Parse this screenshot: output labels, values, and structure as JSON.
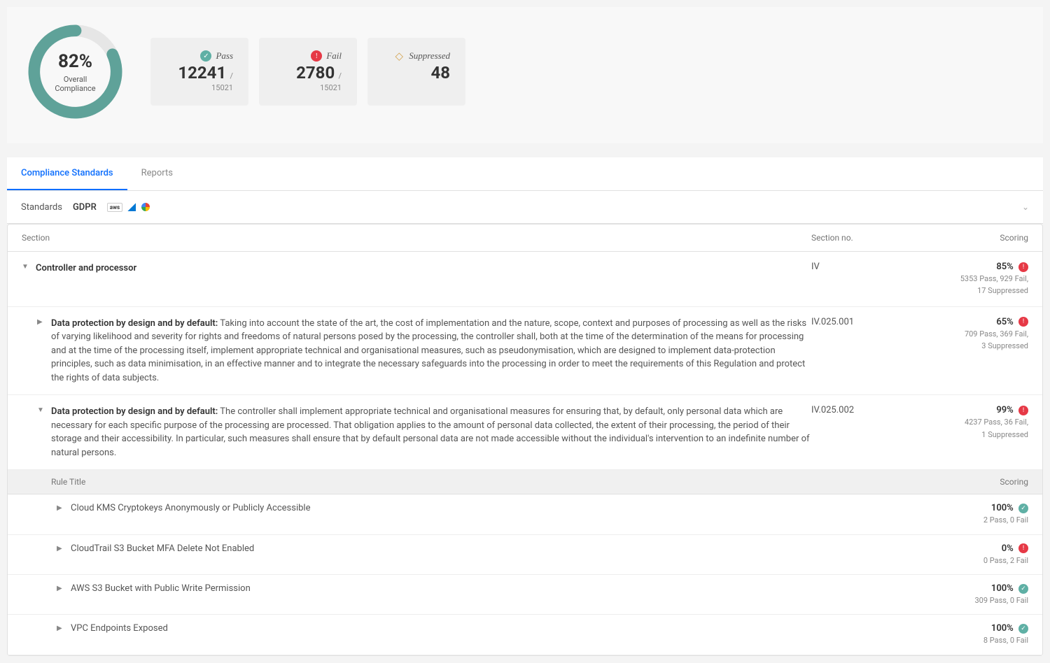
{
  "summary": {
    "overall_pct": "82%",
    "overall_label": "Overall Compliance",
    "pass": {
      "label": "Pass",
      "value": "12241",
      "total": "/ 15021"
    },
    "fail": {
      "label": "Fail",
      "value": "2780",
      "total": "/ 15021"
    },
    "suppressed": {
      "label": "Suppressed",
      "value": "48"
    }
  },
  "tabs": {
    "compliance": "Compliance Standards",
    "reports": "Reports"
  },
  "standards": {
    "label": "Standards",
    "value": "GDPR"
  },
  "table_headers": {
    "section": "Section",
    "section_no": "Section no.",
    "scoring": "Scoring",
    "rule_title": "Rule Title"
  },
  "rows": {
    "main": {
      "title": "Controller and processor",
      "section_no": "IV",
      "score_pct": "85%",
      "score_detail_1": "5353 Pass, 929 Fail,",
      "score_detail_2": "17 Suppressed"
    },
    "sub1": {
      "bold": "Data protection by design and by default:",
      "text": " Taking into account the state of the art, the cost of implementation and the nature, scope, context and purposes of processing as well as the risks of varying likelihood and severity for rights and freedoms of natural persons posed by the processing, the controller shall, both at the time of the determination of the means for processing and at the time of the processing itself, implement appropriate technical and organisational measures, such as pseudonymisation, which are designed to implement data-protection principles, such as data minimisation, in an effective manner and to integrate the necessary safeguards into the processing in order to meet the requirements of this Regulation and protect the rights of data subjects.",
      "section_no": "IV.025.001",
      "score_pct": "65%",
      "score_detail_1": "709 Pass, 369 Fail,",
      "score_detail_2": "3 Suppressed"
    },
    "sub2": {
      "bold": "Data protection by design and by default:",
      "text": " The controller shall implement appropriate technical and organisational measures for ensuring that, by default, only personal data which are necessary for each specific purpose of the processing are processed. That obligation applies to the amount of personal data collected, the extent of their processing, the period of their storage and their accessibility. In particular, such measures shall ensure that by default personal data are not made accessible without the individual's intervention to an indefinite number of natural persons.",
      "section_no": "IV.025.002",
      "score_pct": "99%",
      "score_detail_1": "4237 Pass, 36 Fail,",
      "score_detail_2": "1 Suppressed"
    }
  },
  "rules": [
    {
      "title": "Cloud KMS Cryptokeys Anonymously or Publicly Accessible",
      "pct": "100%",
      "detail": "2 Pass, 0 Fail",
      "status": "pass"
    },
    {
      "title": "CloudTrail S3 Bucket MFA Delete Not Enabled",
      "pct": "0%",
      "detail": "0 Pass, 2 Fail",
      "status": "fail"
    },
    {
      "title": "AWS S3 Bucket with Public Write Permission",
      "pct": "100%",
      "detail": "309 Pass, 0 Fail",
      "status": "pass"
    },
    {
      "title": "VPC Endpoints Exposed",
      "pct": "100%",
      "detail": "8 Pass, 0 Fail",
      "status": "pass"
    }
  ]
}
